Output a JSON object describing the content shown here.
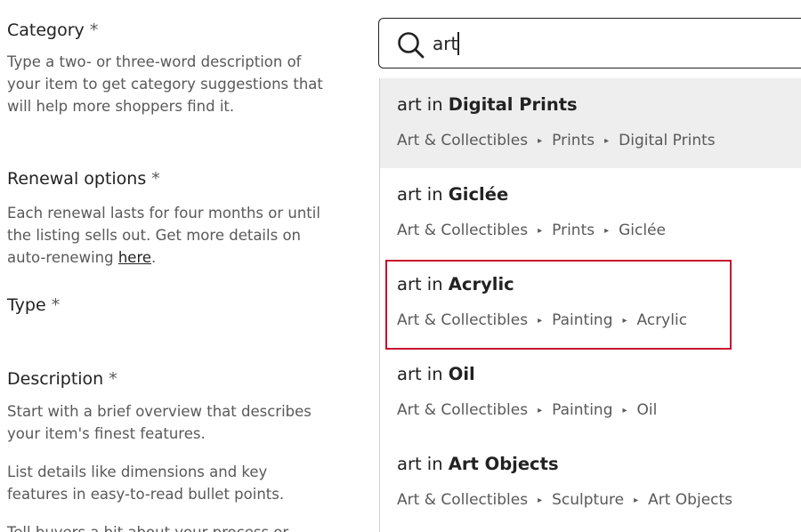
{
  "form": {
    "category": {
      "title": "Category",
      "required_mark": "*",
      "description": "Type a two- or three-word description of your item to get category suggestions that will help more shoppers find it."
    },
    "renewal": {
      "title": "Renewal options",
      "required_mark": "*",
      "description": "Each renewal lasts for four months or until the listing sells out. Get more details on auto-renewing ",
      "link_text": "here",
      "after_link": "."
    },
    "type": {
      "title": "Type",
      "required_mark": "*"
    },
    "description": {
      "title": "Description",
      "required_mark": "*",
      "p1": "Start with a brief overview that describes your item's finest features.",
      "p2": "List details like dimensions and key features in easy-to-read bullet points.",
      "p3": "Tell buyers a bit about your process or"
    }
  },
  "search": {
    "value": "art",
    "icon": "search-icon"
  },
  "suggestions": [
    {
      "prefix": "art in ",
      "category": "Digital Prints",
      "path": [
        "Art & Collectibles",
        "Prints",
        "Digital Prints"
      ],
      "hovered": true,
      "highlighted": false
    },
    {
      "prefix": "art in ",
      "category": "Giclée",
      "path": [
        "Art & Collectibles",
        "Prints",
        "Giclée"
      ],
      "hovered": false,
      "highlighted": false
    },
    {
      "prefix": "art in ",
      "category": "Acrylic",
      "path": [
        "Art & Collectibles",
        "Painting",
        "Acrylic"
      ],
      "hovered": false,
      "highlighted": true
    },
    {
      "prefix": "art in ",
      "category": "Oil",
      "path": [
        "Art & Collectibles",
        "Painting",
        "Oil"
      ],
      "hovered": false,
      "highlighted": false
    },
    {
      "prefix": "art in ",
      "category": "Art Objects",
      "path": [
        "Art & Collectibles",
        "Sculpture",
        "Art Objects"
      ],
      "hovered": false,
      "highlighted": false
    }
  ],
  "path_separator": "▸",
  "colors": {
    "highlight_border": "#c8102e",
    "hover_bg": "#eeeeee",
    "text_primary": "#222222",
    "text_secondary": "#595959"
  }
}
